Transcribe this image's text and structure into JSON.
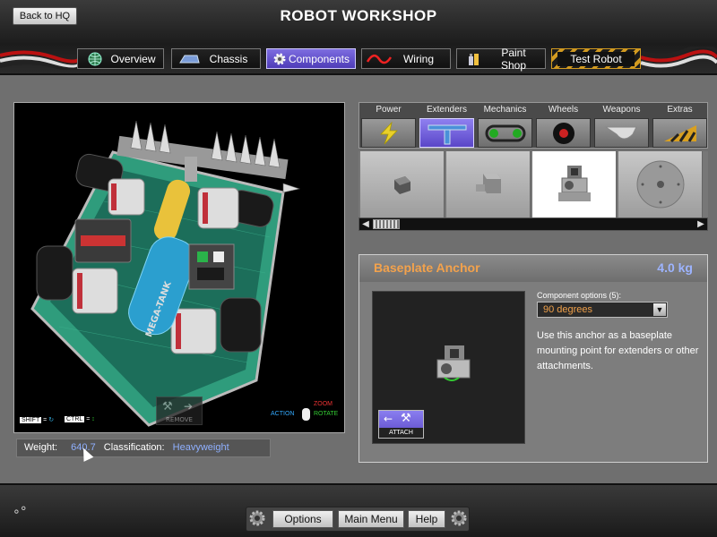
{
  "header": {
    "title": "ROBOT WORKSHOP",
    "back_label": "Back to HQ",
    "tabs": [
      {
        "label": "Overview",
        "icon": "globe-icon"
      },
      {
        "label": "Chassis",
        "icon": "chassis-icon"
      },
      {
        "label": "Components",
        "icon": "gear-icon",
        "active": true
      },
      {
        "label": "Wiring",
        "icon": "wire-icon"
      },
      {
        "label": "Paint Shop",
        "icon": "paint-icon"
      },
      {
        "label": "Test Robot",
        "icon": ""
      }
    ]
  },
  "viewport": {
    "shift_key": "SHIFT",
    "ctrl_key": "CTRL",
    "remove_label": "REMOVE",
    "action_label": "ACTION",
    "zoom_label": "ZOOM",
    "rotate_label": "ROTATE",
    "tank_text": "MEGA-TANK"
  },
  "status": {
    "weight_label": "Weight:",
    "weight_value": "640.7",
    "class_label": "Classification:",
    "class_value": "Heavyweight"
  },
  "categories": [
    {
      "label": "Power",
      "icon": "lightning-icon"
    },
    {
      "label": "Extenders",
      "icon": "extender-icon",
      "active": true
    },
    {
      "label": "Mechanics",
      "icon": "chain-drive-icon"
    },
    {
      "label": "Wheels",
      "icon": "wheel-icon"
    },
    {
      "label": "Weapons",
      "icon": "blade-icon"
    },
    {
      "label": "Extras",
      "icon": "wedge-icon"
    }
  ],
  "parts": [
    {
      "icon": "small-bracket-icon"
    },
    {
      "icon": "box-bracket-icon"
    },
    {
      "icon": "baseplate-anchor-icon",
      "selected": true
    },
    {
      "icon": "disc-plate-icon"
    }
  ],
  "detail": {
    "name": "Baseplate Anchor",
    "weight": "4.0 kg",
    "options_label": "Component options (5):",
    "selected_option": "90 degrees",
    "description": "Use this anchor as a baseplate mounting point for extenders or other attachments.",
    "attach_label": "ATTACH"
  },
  "footer": {
    "options_label": "Options",
    "main_menu_label": "Main Menu",
    "help_label": "Help"
  },
  "colors": {
    "accent": "#6a5acd",
    "name_orange": "#f3a24c",
    "weight_blue": "#9db4ff"
  }
}
